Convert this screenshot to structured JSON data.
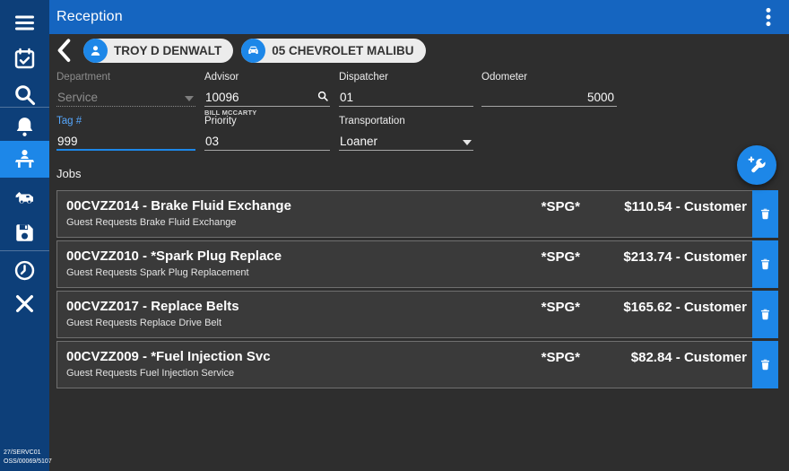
{
  "colors": {
    "sidebar": "#0d3f79",
    "header": "#1565c0",
    "accent": "#1d87e8",
    "content_bg": "#2e2e2e",
    "row_bg": "#3a3a3a",
    "row_border": "#6f6f6f",
    "pill_bg": "#ececec",
    "pill_text": "#333333",
    "muted": "#8d8d8d",
    "tag_label": "#56a8ff"
  },
  "header": {
    "title": "Reception"
  },
  "sidebar": {
    "items": [
      {
        "id": "menu",
        "icon": "hamburger-icon",
        "active": false,
        "divider_before": false
      },
      {
        "id": "appointments",
        "icon": "calendar-check-icon",
        "active": false,
        "divider_before": false
      },
      {
        "id": "search",
        "icon": "search-icon",
        "active": false,
        "divider_before": false
      },
      {
        "id": "notifications",
        "icon": "bell-icon",
        "active": false,
        "divider_before": true
      },
      {
        "id": "reception",
        "icon": "reception-desk-icon",
        "active": true,
        "divider_before": false
      },
      {
        "id": "vehicle-writeup",
        "icon": "car-edit-icon",
        "active": false,
        "divider_before": false
      },
      {
        "id": "save",
        "icon": "save-icon",
        "active": false,
        "divider_before": false
      },
      {
        "id": "history",
        "icon": "clock-icon",
        "active": false,
        "divider_before": true
      },
      {
        "id": "close",
        "icon": "close-icon",
        "active": false,
        "divider_before": false
      }
    ],
    "footer_line1": "27/SERVC01",
    "footer_line2": "OSS/00069/5107"
  },
  "context": {
    "customer_pill": "TROY D DENWALT",
    "vehicle_pill": "05 CHEVROLET MALIBU"
  },
  "form": {
    "department": {
      "label": "Department",
      "value": "Service"
    },
    "advisor": {
      "label": "Advisor",
      "value": "10096",
      "helper": "BILL MCCARTY"
    },
    "dispatcher": {
      "label": "Dispatcher",
      "value": "01"
    },
    "odometer": {
      "label": "Odometer",
      "value": "5000"
    },
    "tag": {
      "label": "Tag #",
      "value": "999"
    },
    "priority": {
      "label": "Priority",
      "value": "03"
    },
    "transportation": {
      "label": "Transportation",
      "value": "Loaner"
    }
  },
  "jobs": {
    "section_label": "Jobs",
    "items": [
      {
        "title": "00CVZZ014 - Brake Fluid Exchange",
        "subtitle": "Guest Requests Brake Fluid Exchange",
        "tag": "*SPG*",
        "price": "$110.54 - Customer"
      },
      {
        "title": "00CVZZ010 - *Spark Plug Replace",
        "subtitle": "Guest Requests Spark Plug Replacement",
        "tag": "*SPG*",
        "price": "$213.74 - Customer"
      },
      {
        "title": "00CVZZ017 - Replace Belts",
        "subtitle": "Guest Requests Replace Drive Belt",
        "tag": "*SPG*",
        "price": "$165.62 - Customer"
      },
      {
        "title": "00CVZZ009 - *Fuel Injection Svc",
        "subtitle": "Guest Requests Fuel Injection Service",
        "tag": "*SPG*",
        "price": "$82.84 - Customer"
      }
    ]
  }
}
